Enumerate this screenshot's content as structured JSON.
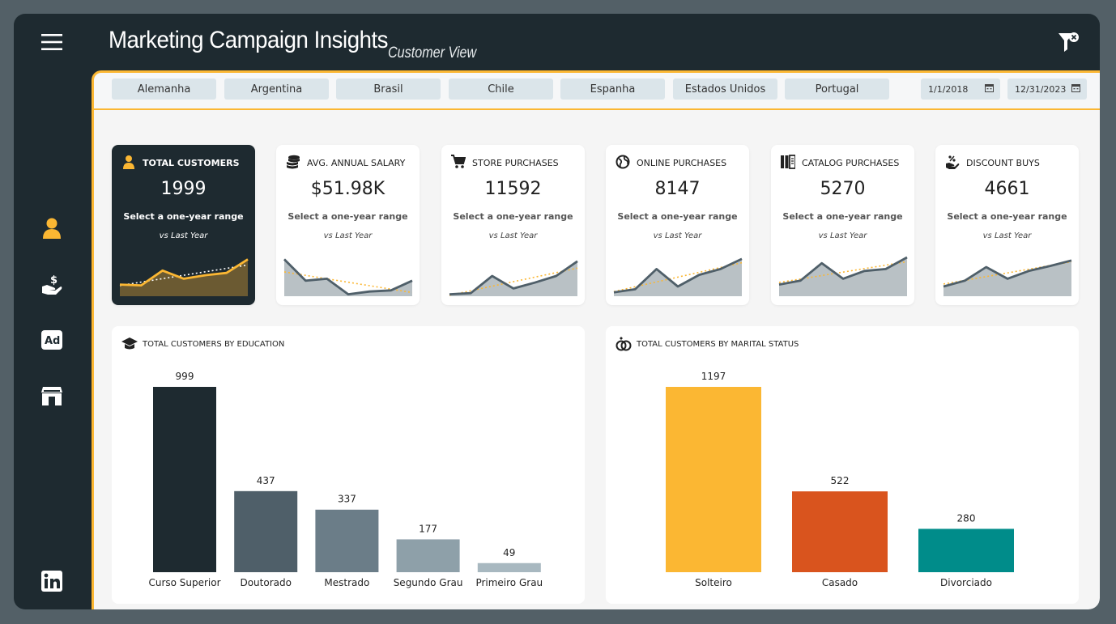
{
  "header": {
    "title": "Marketing Campaign Insights",
    "subtitle": "Customer View"
  },
  "sidebar": {
    "items": [
      {
        "name": "person-icon",
        "color": "#fbb733"
      },
      {
        "name": "salary-hand-icon",
        "color": "#ffffff"
      },
      {
        "name": "ad-icon",
        "color": "#ffffff"
      },
      {
        "name": "store-icon",
        "color": "#ffffff"
      },
      {
        "name": "linkedin-icon",
        "color": "#ffffff"
      }
    ]
  },
  "filters": {
    "countries": [
      "Alemanha",
      "Argentina",
      "Brasil",
      "Chile",
      "Espanha",
      "Estados Unidos",
      "Portugal"
    ],
    "date_start": "1/1/2018",
    "date_end": "12/31/2023"
  },
  "kpis": [
    {
      "label": "TOTAL CUSTOMERS",
      "value": "1999",
      "select": "Select a one-year range",
      "vs": "vs Last Year",
      "icon": "person-icon",
      "dark": true,
      "spark": [
        0.3,
        0.28,
        0.66,
        0.45,
        0.54,
        0.6,
        0.95
      ]
    },
    {
      "label": "AVG. ANNUAL SALARY",
      "value": "$51.98K",
      "select": "Select a one-year range",
      "vs": "vs Last Year",
      "icon": "coins-icon",
      "dark": false,
      "spark": [
        0.95,
        0.4,
        0.45,
        0.05,
        0.12,
        0.15,
        0.4
      ]
    },
    {
      "label": "STORE PURCHASES",
      "value": "11592",
      "select": "Select a one-year range",
      "vs": "vs Last Year",
      "icon": "cart-icon",
      "dark": false,
      "spark": [
        0.05,
        0.08,
        0.52,
        0.2,
        0.35,
        0.52,
        0.9
      ]
    },
    {
      "label": "ONLINE PURCHASES",
      "value": "8147",
      "select": "Select a one-year range",
      "vs": "vs Last Year",
      "icon": "globe-icon",
      "dark": false,
      "spark": [
        0.1,
        0.18,
        0.7,
        0.25,
        0.55,
        0.7,
        0.96
      ]
    },
    {
      "label": "CATALOG PURCHASES",
      "value": "5270",
      "select": "Select a one-year range",
      "vs": "vs Last Year",
      "icon": "catalog-icon",
      "dark": false,
      "spark": [
        0.3,
        0.4,
        0.85,
        0.45,
        0.65,
        0.7,
        1.0
      ]
    },
    {
      "label": "DISCOUNT BUYS",
      "value": "4661",
      "select": "Select a one-year range",
      "vs": "vs Last Year",
      "icon": "discount-hand-icon",
      "dark": false,
      "spark": [
        0.25,
        0.4,
        0.75,
        0.45,
        0.65,
        0.78,
        0.92
      ]
    }
  ],
  "chart_data": [
    {
      "type": "bar",
      "title": "TOTAL CUSTOMERS BY EDUCATION",
      "categories": [
        "Curso Superior",
        "Doutorado",
        "Mestrado",
        "Segundo Grau",
        "Primeiro Grau"
      ],
      "values": [
        999,
        437,
        337,
        177,
        49
      ],
      "colors": [
        "#1e2a30",
        "#4f5f69",
        "#6b7d88",
        "#8ea0a9",
        "#a8b8c0"
      ],
      "ylim": [
        0,
        999
      ]
    },
    {
      "type": "bar",
      "title": "TOTAL CUSTOMERS BY MARITAL STATUS",
      "categories": [
        "Solteiro",
        "Casado",
        "Divorciado"
      ],
      "values": [
        1197,
        522,
        280
      ],
      "colors": [
        "#fbb733",
        "#d9541e",
        "#008c8a"
      ],
      "ylim": [
        0,
        1197
      ]
    }
  ]
}
